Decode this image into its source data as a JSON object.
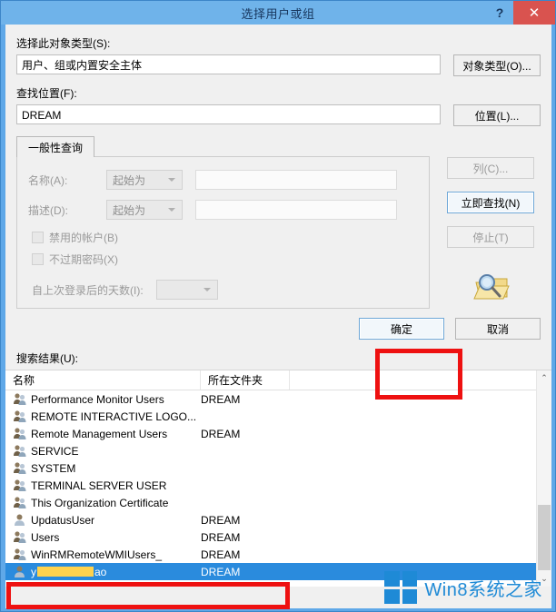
{
  "window": {
    "title": "选择用户或组",
    "help_label": "?",
    "close_label": "✕",
    "titlebar_color": "#6fb3ea",
    "border_color": "#5fa8e8",
    "close_color": "#d9534f"
  },
  "object_type": {
    "label": "选择此对象类型(S):",
    "value": "用户、组或内置安全主体",
    "button": "对象类型(O)..."
  },
  "location": {
    "label": "查找位置(F):",
    "value": "DREAM",
    "button": "位置(L)..."
  },
  "tabs": [
    {
      "label": "一般性查询",
      "active": true
    }
  ],
  "query": {
    "name": {
      "label": "名称(A):",
      "operator": "起始为",
      "value": "",
      "disabled": true
    },
    "description": {
      "label": "描述(D):",
      "operator": "起始为",
      "value": "",
      "disabled": true
    },
    "checkboxes": [
      {
        "label": "禁用的帐户(B)",
        "checked": false,
        "disabled": true
      },
      {
        "label": "不过期密码(X)",
        "checked": false,
        "disabled": true
      }
    ],
    "days_since_logon": {
      "label": "自上次登录后的天数(I):",
      "value": "",
      "disabled": true
    }
  },
  "side_buttons": [
    {
      "label": "列(C)...",
      "state": "disabled"
    },
    {
      "label": "立即查找(N)",
      "state": "default"
    },
    {
      "label": "停止(T)",
      "state": "disabled"
    }
  ],
  "side_icon": "magnifier-folder-icon",
  "actions": {
    "ok": "确定",
    "cancel": "取消"
  },
  "results": {
    "label": "搜索结果(U):",
    "columns": [
      "名称",
      "所在文件夹"
    ],
    "rows": [
      {
        "name": "Performance Monitor Users",
        "folder": "DREAM",
        "icon": "group-icon",
        "selected": false
      },
      {
        "name": "REMOTE INTERACTIVE LOGO...",
        "folder": "",
        "icon": "group-icon",
        "selected": false
      },
      {
        "name": "Remote Management Users",
        "folder": "DREAM",
        "icon": "group-icon",
        "selected": false
      },
      {
        "name": "SERVICE",
        "folder": "",
        "icon": "group-icon",
        "selected": false
      },
      {
        "name": "SYSTEM",
        "folder": "",
        "icon": "group-icon",
        "selected": false
      },
      {
        "name": "TERMINAL SERVER USER",
        "folder": "",
        "icon": "group-icon",
        "selected": false
      },
      {
        "name": "This Organization Certificate",
        "folder": "",
        "icon": "group-icon",
        "selected": false
      },
      {
        "name": "UpdatusUser",
        "folder": "DREAM",
        "icon": "user-icon",
        "selected": false
      },
      {
        "name": "Users",
        "folder": "DREAM",
        "icon": "group-icon",
        "selected": false
      },
      {
        "name": "WinRMRemoteWMIUsers_",
        "folder": "DREAM",
        "icon": "group-icon",
        "selected": false
      },
      {
        "name_prefix": "y",
        "name_suffix": "ao",
        "redacted": true,
        "folder": "DREAM",
        "icon": "user-icon",
        "selected": true
      }
    ],
    "scroll_up": "⌃",
    "scroll_down": "⌄"
  },
  "annotations": {
    "color": "#ee1111",
    "boxes": [
      "ok-button",
      "selected-result-row"
    ]
  },
  "watermark": {
    "text": "Win8系统之家",
    "color": "#1e8ad6"
  }
}
